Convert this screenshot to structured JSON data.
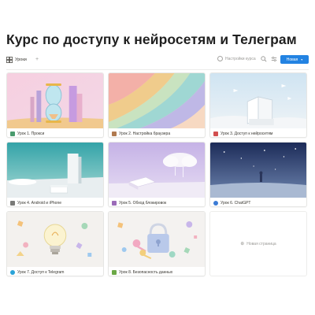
{
  "page": {
    "title": "Курс по доступу к нейросетям и Телеграм"
  },
  "toolbar": {
    "view_label": "Уроки",
    "add_view": "+",
    "search_placeholder": "Настройки курса",
    "new_label": "Новая",
    "accent": "#2383e2"
  },
  "cards": [
    {
      "title": "Урок 1. Прокси",
      "icon": "doc-icon",
      "icon_color": "#4a9b6e"
    },
    {
      "title": "Урок 2. Настройка браузера",
      "icon": "gear-icon",
      "icon_color": "#b07a4f"
    },
    {
      "title": "Урок 3. Доступ к нейросетям",
      "icon": "pin-icon",
      "icon_color": "#d24f4f"
    },
    {
      "title": "Урок 4. Android и iPhone",
      "icon": "phone-icon",
      "icon_color": "#7a7a78"
    },
    {
      "title": "Урок 5. Обход блокировок",
      "icon": "heart-icon",
      "icon_color": "#9b6bb8"
    },
    {
      "title": "Урок 6. ChatGPT",
      "icon": "globe-icon",
      "icon_color": "#3b7bd5"
    },
    {
      "title": "Урок 7. Доступ к Telegram",
      "icon": "telegram-icon",
      "icon_color": "#2aa3d8"
    },
    {
      "title": "Урок 8. Безопасность данных",
      "icon": "leaf-icon",
      "icon_color": "#6ba846"
    }
  ],
  "new_page": {
    "label": "Новая страница",
    "icon": "plus-icon"
  }
}
